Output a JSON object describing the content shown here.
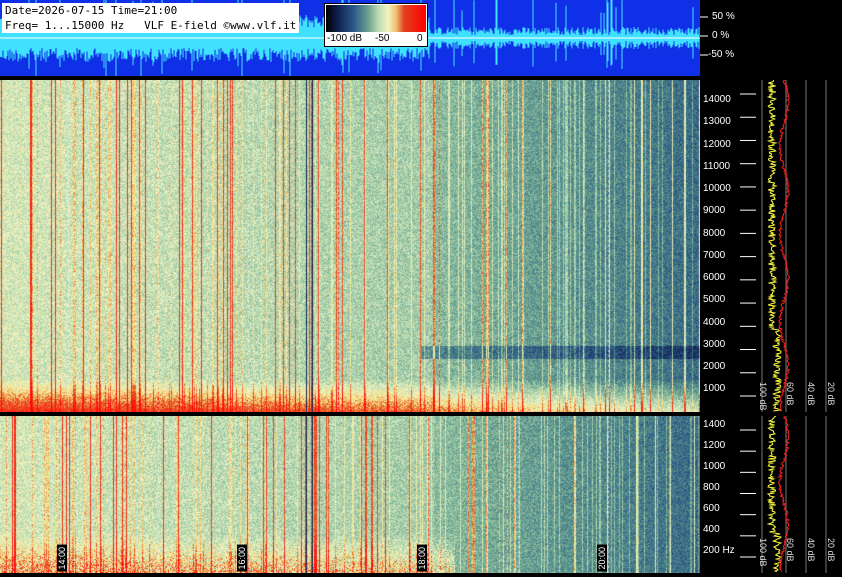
{
  "header": {
    "line1": "Date=2026-07-15 Time=21:00",
    "line2": "Freq= 1...15000 Hz   VLF E-field ©www.vlf.it"
  },
  "colorbar": {
    "labels": [
      "-100 dB",
      "-50",
      "0"
    ]
  },
  "amplitude_scale": {
    "labels": [
      "50 %",
      "0 %",
      "-50 %"
    ]
  },
  "top_panel": {
    "freq_labels": [
      "14000",
      "13000",
      "12000",
      "11000",
      "10000",
      "9000",
      "8000",
      "7000",
      "6000",
      "5000",
      "4000",
      "3000",
      "2000",
      "1000"
    ],
    "db_labels": [
      "100 dB",
      "60 dB",
      "40 dB",
      "20 dB"
    ]
  },
  "bottom_panel": {
    "freq_labels": [
      "1400",
      "1200",
      "1000",
      "800",
      "600",
      "400",
      "200 Hz"
    ],
    "db_labels": [
      "100 dB",
      "60 dB",
      "40 dB",
      "20 dB"
    ]
  },
  "time_markers": [
    "14:00",
    "16:00",
    "18:00",
    "20:00"
  ],
  "colors": {
    "waveform_bg": "#1030e8",
    "waveform_trace": "#40e0ff",
    "spectrum_yellow": "#ffff40",
    "spectrum_red": "#ff2020"
  }
}
